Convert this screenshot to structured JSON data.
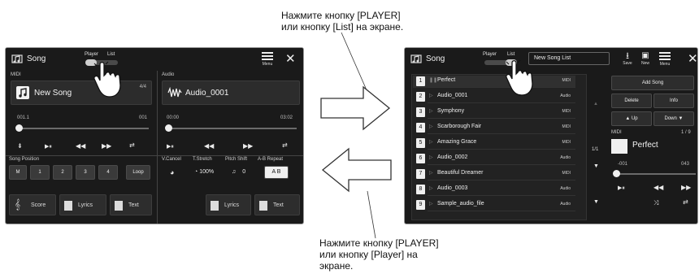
{
  "callouts": {
    "top_line1": "Нажмите кнопку [PLAYER]",
    "top_line2": "или кнопку [List] на экране.",
    "bottom_line1": "Нажмите кнопку [PLAYER]",
    "bottom_line2": "или кнопку [Player] на",
    "bottom_line3": "экране."
  },
  "player_screen": {
    "title": "Song",
    "switch_player": "Player",
    "switch_list": "List",
    "menu_label": "Menu",
    "close": "✕",
    "midi": {
      "label": "MIDI",
      "song_name": "New Song",
      "time_sig": "4/4",
      "position": "001.1",
      "total": "001",
      "song_position_label": "Song Position",
      "position_buttons": [
        "M",
        "1",
        "2",
        "3",
        "4",
        "Loop"
      ],
      "score_label": "Score",
      "lyrics_label": "Lyrics",
      "text_label": "Text"
    },
    "audio": {
      "label": "Audio",
      "song_name": "Audio_0001",
      "time": "00:00",
      "total": "03:02",
      "vcancel_label": "V.Cancel",
      "tstretch_label": "T.Stretch",
      "pitch_label": "Pitch Shift",
      "ab_label": "A-B Repeat",
      "tstretch_value": "100%",
      "pitch_value": "0",
      "ab_button": "A B",
      "lyrics_label": "Lyrics",
      "text_label": "Text"
    }
  },
  "list_screen": {
    "title": "Song",
    "switch_player": "Player",
    "switch_list": "List",
    "list_name": "New Song List",
    "save_label": "Save",
    "new_label": "New",
    "menu_label": "Menu",
    "close": "✕",
    "songs": [
      {
        "num": "1",
        "title": "Perfect",
        "type": "MIDI"
      },
      {
        "num": "2",
        "title": "Audio_0001",
        "type": "Audio"
      },
      {
        "num": "3",
        "title": "Symphony",
        "type": "MIDI"
      },
      {
        "num": "4",
        "title": "Scarborough Fair",
        "type": "MIDI"
      },
      {
        "num": "5",
        "title": "Amazing Grace",
        "type": "MIDI"
      },
      {
        "num": "6",
        "title": "Audio_0002",
        "type": "Audio"
      },
      {
        "num": "7",
        "title": "Beautiful Dreamer",
        "type": "MIDI"
      },
      {
        "num": "8",
        "title": "Audio_0003",
        "type": "Audio"
      },
      {
        "num": "9",
        "title": "Sample_audio_file",
        "type": "Audio"
      }
    ],
    "page_indicator": "1/1",
    "add_song": "Add Song",
    "delete": "Delete",
    "info": "Info",
    "up": "Up",
    "down": "Down",
    "midi_label": "MIDI",
    "midi_count": "1 / 9",
    "now_playing": "Perfect",
    "position": "-001",
    "total": "043"
  }
}
